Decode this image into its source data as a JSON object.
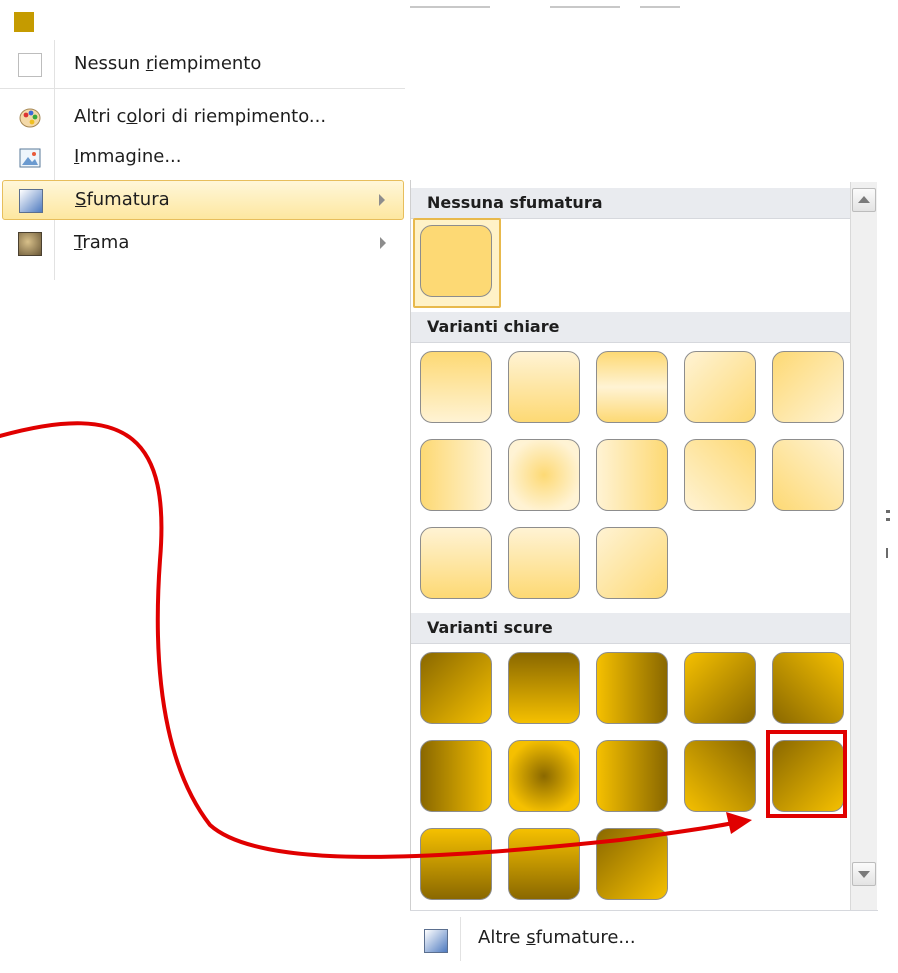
{
  "colors": {
    "gold": "#c59b00",
    "light_gold": "#fdd974",
    "highlight_fill": "#fde7a0",
    "annotation_red": "#e00000"
  },
  "menu": {
    "items": [
      {
        "label_pre": "Nessun ",
        "label_acc": "r",
        "label_post": "iempimento",
        "icon": "no-fill-icon"
      },
      {
        "label_pre": "Altri c",
        "label_acc": "o",
        "label_post": "lori di riempimento...",
        "icon": "palette-icon"
      },
      {
        "label_pre": "",
        "label_acc": "I",
        "label_post": "mmagine...",
        "icon": "picture-icon"
      },
      {
        "label_pre": "",
        "label_acc": "S",
        "label_post": "fumatura",
        "icon": "gradient-icon",
        "highlighted": true,
        "submenu": true
      },
      {
        "label_pre": "",
        "label_acc": "T",
        "label_post": "rama",
        "icon": "texture-icon",
        "submenu": true
      }
    ]
  },
  "gallery": {
    "sections": {
      "none": "Nessuna sfumatura",
      "light": "Varianti chiare",
      "dark": "Varianti scure"
    },
    "footer_pre": "Altre ",
    "footer_acc": "s",
    "footer_post": "fumature..."
  }
}
